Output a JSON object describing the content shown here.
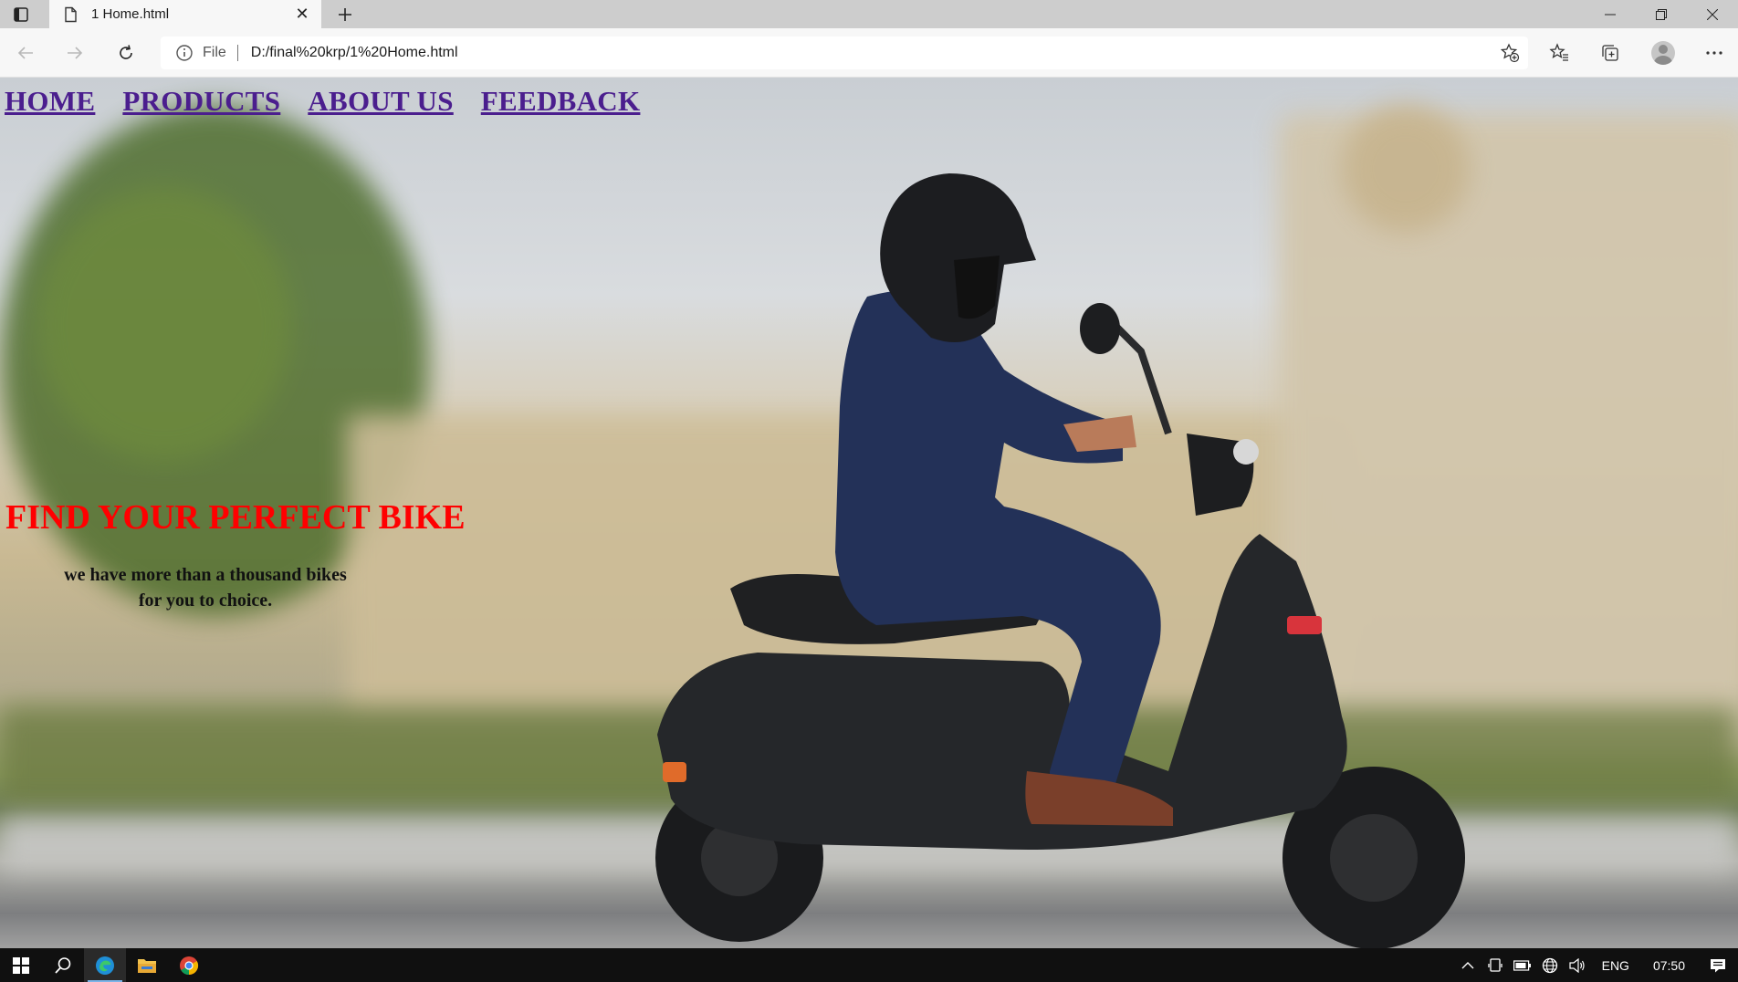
{
  "browser": {
    "tab_title": "1 Home.html",
    "address_scheme": "File",
    "address_url": "D:/final%20krp/1%20Home.html"
  },
  "page": {
    "nav": [
      "HOME",
      "PRODUCTS",
      "ABOUT US",
      "FEEDBACK"
    ],
    "headline": "FIND YOUR PERFECT BIKE",
    "tagline_line1": "we have more than a thousand bikes",
    "tagline_line2": "for you to choice."
  },
  "taskbar": {
    "lang": "ENG",
    "time": "07:50"
  },
  "colors": {
    "nav_link": "#4b1e8e",
    "headline": "#ff0000",
    "tagline": "#111111"
  }
}
